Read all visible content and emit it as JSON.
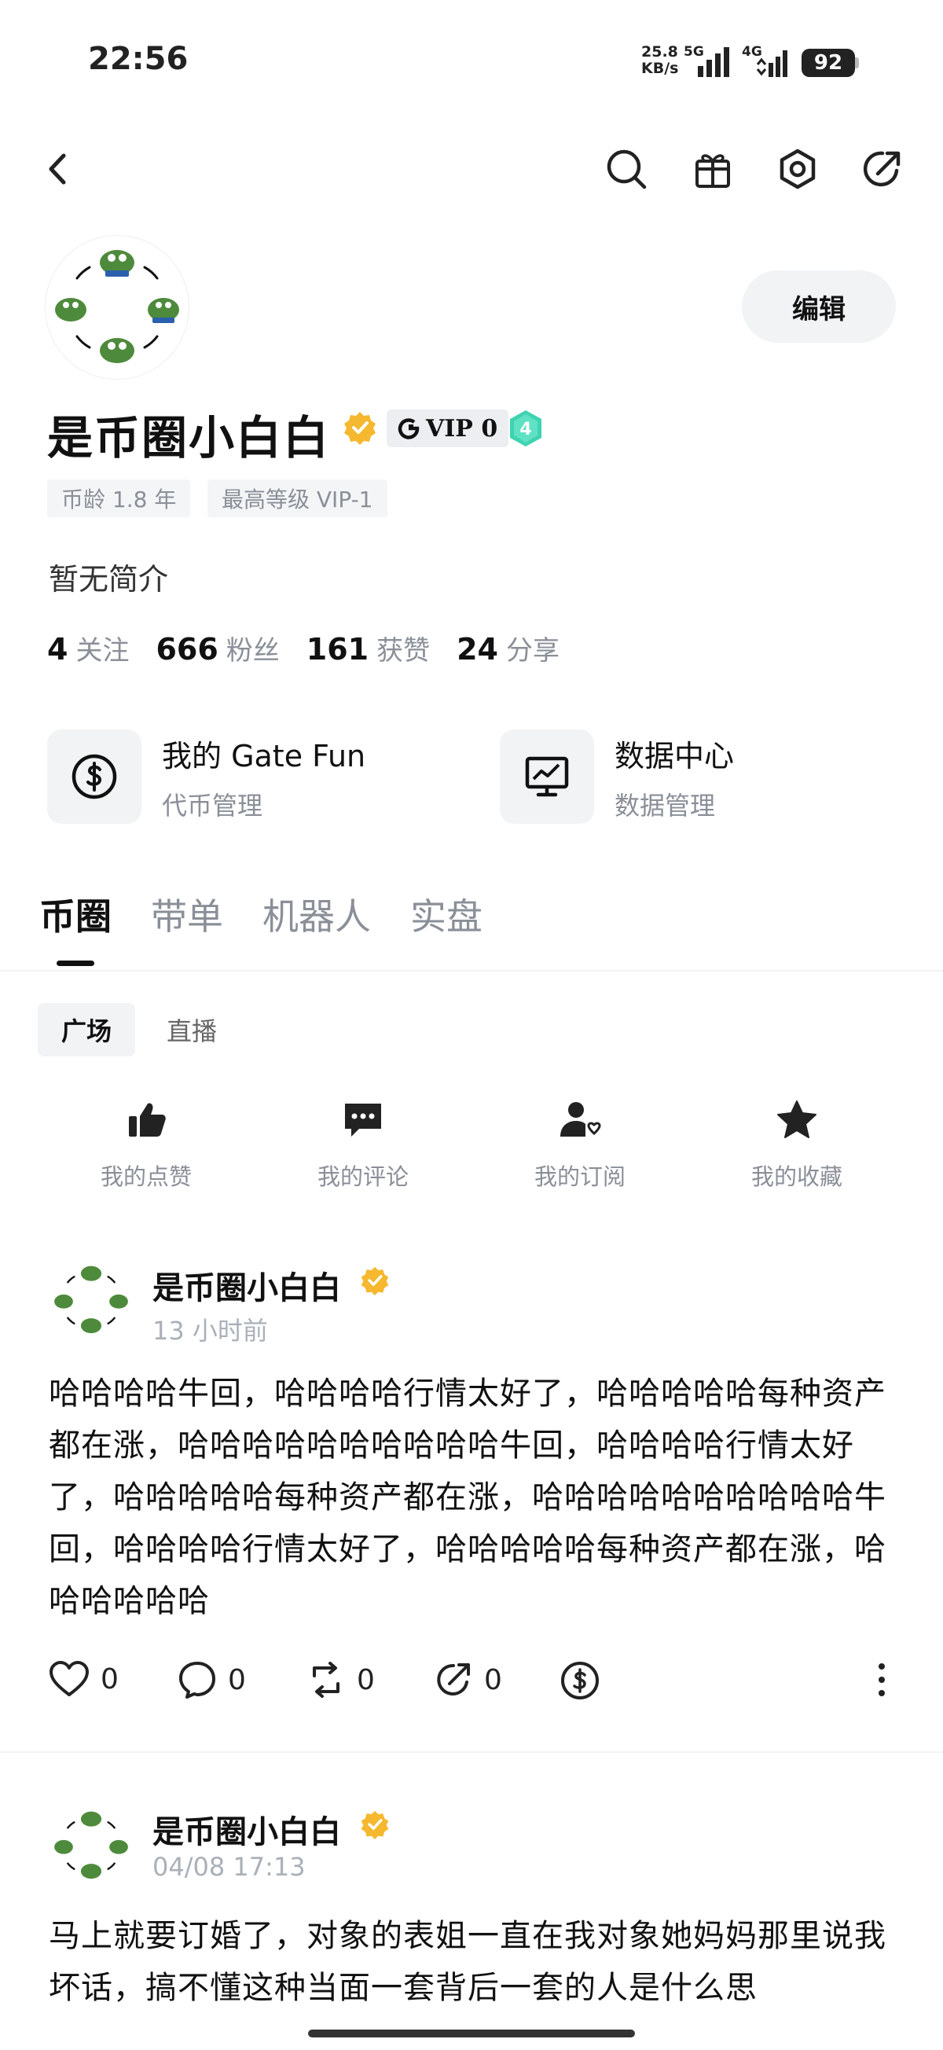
{
  "status_bar": {
    "time": "22:56",
    "speed_value": "25.8",
    "speed_unit": "KB/s",
    "network1": "5G",
    "network2": "4G",
    "battery": "92"
  },
  "profile": {
    "username": "是币圈小白白",
    "vip_label": "VIP 0",
    "level": "4",
    "edit_label": "编辑",
    "tags": [
      "币龄 1.8 年",
      "最高等级 VIP-1"
    ],
    "bio": "暂无简介",
    "stats": [
      {
        "value": "4",
        "label": "关注"
      },
      {
        "value": "666",
        "label": "粉丝"
      },
      {
        "value": "161",
        "label": "获赞"
      },
      {
        "value": "24",
        "label": "分享"
      }
    ]
  },
  "features": [
    {
      "title": "我的 Gate Fun",
      "subtitle": "代币管理",
      "icon": "dollar-circle-icon"
    },
    {
      "title": "数据中心",
      "subtitle": "数据管理",
      "icon": "chart-monitor-icon"
    }
  ],
  "tabs": [
    "币圈",
    "带单",
    "机器人",
    "实盘"
  ],
  "subtabs": [
    "广场",
    "直播"
  ],
  "quick_actions": [
    {
      "label": "我的点赞",
      "icon": "thumbs-up-icon"
    },
    {
      "label": "我的评论",
      "icon": "comment-icon"
    },
    {
      "label": "我的订阅",
      "icon": "subscribe-user-icon"
    },
    {
      "label": "我的收藏",
      "icon": "star-icon"
    }
  ],
  "posts": [
    {
      "author": "是币圈小白白",
      "time": "13 小时前",
      "body": "哈哈哈哈牛回，哈哈哈哈行情太好了，哈哈哈哈哈每种资产都在涨，哈哈哈哈哈哈哈哈哈哈牛回，哈哈哈哈行情太好了，哈哈哈哈哈每种资产都在涨，哈哈哈哈哈哈哈哈哈哈牛回，哈哈哈哈行情太好了，哈哈哈哈哈每种资产都在涨，哈哈哈哈哈哈",
      "likes": "0",
      "comments": "0",
      "reposts": "0",
      "shares": "0"
    },
    {
      "author": "是币圈小白白",
      "time": "04/08 17:13",
      "body": "马上就要订婚了，对象的表姐一直在我对象她妈妈那里说我坏话，搞不懂这种当面一套背后一套的人是什么思"
    }
  ],
  "colors": {
    "verify_gold": "#F5B82E",
    "level_teal": "#3FD3B1",
    "muted_text": "#8A8F98",
    "chip_bg": "#F2F3F5"
  }
}
